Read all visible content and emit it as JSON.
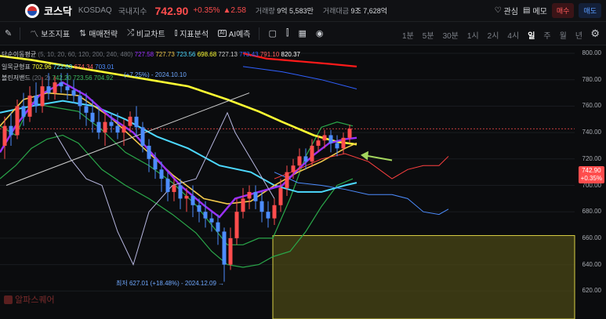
{
  "header": {
    "title": "코스닥",
    "market": "KOSDAQ",
    "type": "국내지수",
    "price": "742.90",
    "change_pct": "+0.35%",
    "change": "▲2.58",
    "volume_label": "거래량",
    "volume_value": "9억 5,583만",
    "amount_label": "거래대금",
    "amount_value": "9조 7,628억",
    "watch_label": "관심",
    "memo_label": "메모",
    "buy_label": "매수",
    "sell_label": "매도"
  },
  "toolbar": {
    "indicators": "보조지표",
    "strategy": "매매전략",
    "compare": "비교차트",
    "analysis": "지표분석",
    "ai": "AI예측",
    "timeframes": [
      "1분",
      "5분",
      "30분",
      "1시",
      "2시",
      "4시",
      "일",
      "주",
      "월",
      "년"
    ],
    "active_timeframe": "일"
  },
  "legend": {
    "ma_label": "단순이동평균",
    "ma_params": "(5, 10, 20, 60, 120, 200, 240, 480)",
    "ma_values": [
      "727.58",
      "727.73",
      "723.56",
      "698.68",
      "727.13",
      "773.43",
      "791.10",
      "820.37"
    ],
    "ichi_label": "일목균형표",
    "ichi_values": [
      "702.96",
      "722.63",
      "674.34",
      "703.01"
    ],
    "bb_label": "볼린저밴드",
    "bb_params": "(20, 2)",
    "bb_values": [
      "742.20",
      "723.56",
      "704.92"
    ],
    "hi_note": "(+7.25%) - 2024.10.10"
  },
  "yaxis": [
    "800.00",
    "780.00",
    "760.00",
    "740.00",
    "720.00",
    "700.00",
    "680.00",
    "660.00",
    "640.00",
    "620.00"
  ],
  "price_tag": {
    "price": "742.90",
    "pct": "+0.35%"
  },
  "low_marker": "최저 627.01 (+18.48%) - 2024.12.09 →",
  "watermark": "알파스퀘어",
  "colors": {
    "up": "#ff4d4d",
    "down": "#4d8dff",
    "ma5": "#9b30ff",
    "ma10": "#f2c94c",
    "ma20": "#4dd9ff",
    "ma60": "#ffff33",
    "ma480": "#ff1a1a"
  }
}
